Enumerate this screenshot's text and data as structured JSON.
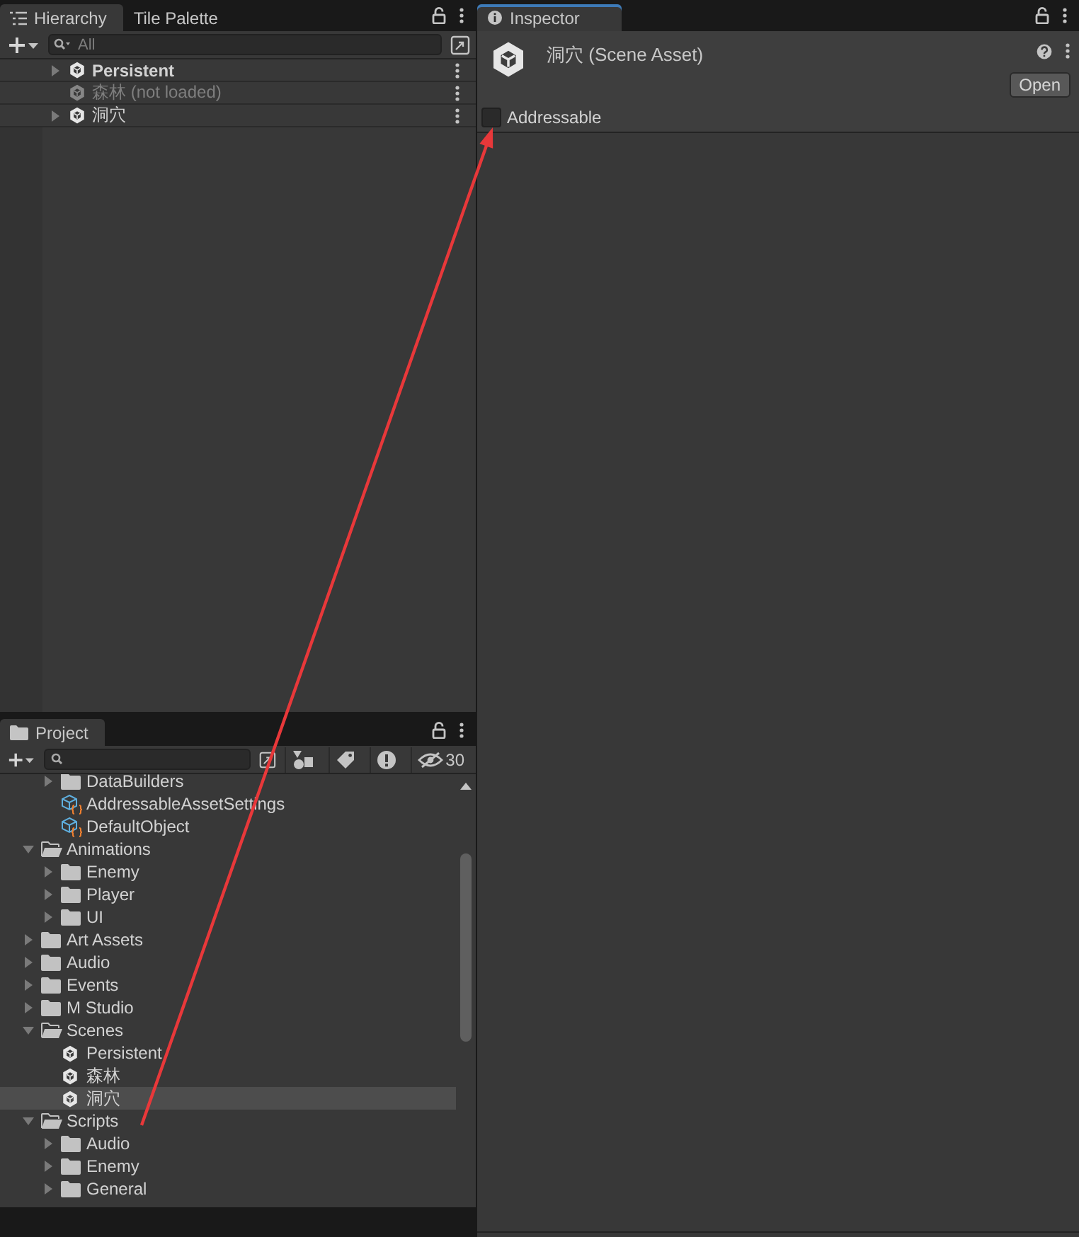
{
  "hierarchy": {
    "tabs": [
      {
        "label": "Hierarchy",
        "selected": true
      },
      {
        "label": "Tile Palette",
        "selected": false
      }
    ],
    "search": {
      "placeholder": "All"
    },
    "items": [
      {
        "label": "Persistent",
        "active": true,
        "loaded": true,
        "expanded": false,
        "selected": false
      },
      {
        "label": "森林 (not loaded)",
        "active": false,
        "loaded": false,
        "selected": false
      },
      {
        "label": "洞穴",
        "active": false,
        "loaded": true,
        "expanded": false,
        "selected": false
      }
    ]
  },
  "project": {
    "tabs": [
      {
        "label": "Project",
        "selected": true
      }
    ],
    "hidden_count": "30",
    "scrolled_folder_items": [
      {
        "kind": "folder",
        "label": "DataBuilders",
        "expanded": false,
        "selected": false
      },
      {
        "kind": "asset",
        "label": "AddressableAssetSettings",
        "selected": false
      },
      {
        "kind": "asset",
        "label": "DefaultObject",
        "selected": false
      }
    ],
    "tree": [
      {
        "kind": "folder",
        "label": "Animations",
        "expanded": true,
        "selected": false,
        "children": [
          {
            "kind": "folder",
            "label": "Enemy",
            "expanded": false,
            "selected": false
          },
          {
            "kind": "folder",
            "label": "Player",
            "expanded": false,
            "selected": false
          },
          {
            "kind": "folder",
            "label": "UI",
            "expanded": false,
            "selected": false
          }
        ]
      },
      {
        "kind": "folder",
        "label": "Art Assets",
        "expanded": false,
        "selected": false
      },
      {
        "kind": "folder",
        "label": "Audio",
        "expanded": false,
        "selected": false
      },
      {
        "kind": "folder",
        "label": "Events",
        "expanded": false,
        "selected": false
      },
      {
        "kind": "folder",
        "label": "M Studio",
        "expanded": false,
        "selected": false
      },
      {
        "kind": "folder",
        "label": "Scenes",
        "expanded": true,
        "selected": false,
        "children": [
          {
            "kind": "scene",
            "label": "Persistent",
            "selected": false
          },
          {
            "kind": "scene",
            "label": "森林",
            "selected": false
          },
          {
            "kind": "scene",
            "label": "洞穴",
            "selected": true
          }
        ]
      },
      {
        "kind": "folder",
        "label": "Scripts",
        "expanded": true,
        "selected": false,
        "children": [
          {
            "kind": "folder",
            "label": "Audio",
            "expanded": false,
            "selected": false
          },
          {
            "kind": "folder",
            "label": "Enemy",
            "expanded": false,
            "selected": false
          },
          {
            "kind": "folder",
            "label": "General",
            "expanded": false,
            "selected": false
          }
        ]
      }
    ]
  },
  "inspector": {
    "tabs": [
      {
        "label": "Inspector",
        "selected": true
      }
    ],
    "title": "洞穴 (Scene Asset)",
    "open_button": "Open",
    "addressable": {
      "label": "Addressable",
      "checked": false
    }
  }
}
